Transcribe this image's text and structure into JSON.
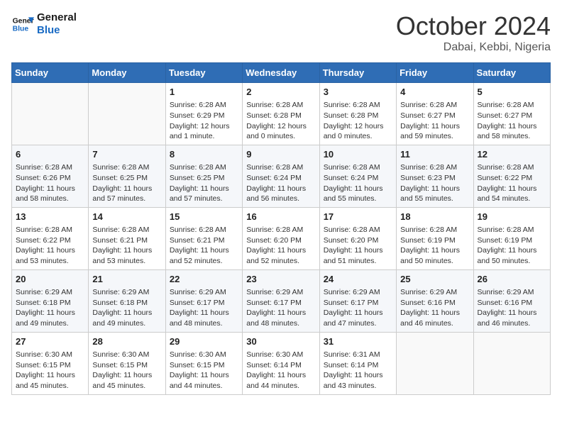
{
  "logo": {
    "line1": "General",
    "line2": "Blue"
  },
  "title": "October 2024",
  "subtitle": "Dabai, Kebbi, Nigeria",
  "weekdays": [
    "Sunday",
    "Monday",
    "Tuesday",
    "Wednesday",
    "Thursday",
    "Friday",
    "Saturday"
  ],
  "weeks": [
    [
      {
        "day": "",
        "info": ""
      },
      {
        "day": "",
        "info": ""
      },
      {
        "day": "1",
        "info": "Sunrise: 6:28 AM\nSunset: 6:29 PM\nDaylight: 12 hours and 1 minute."
      },
      {
        "day": "2",
        "info": "Sunrise: 6:28 AM\nSunset: 6:28 PM\nDaylight: 12 hours and 0 minutes."
      },
      {
        "day": "3",
        "info": "Sunrise: 6:28 AM\nSunset: 6:28 PM\nDaylight: 12 hours and 0 minutes."
      },
      {
        "day": "4",
        "info": "Sunrise: 6:28 AM\nSunset: 6:27 PM\nDaylight: 11 hours and 59 minutes."
      },
      {
        "day": "5",
        "info": "Sunrise: 6:28 AM\nSunset: 6:27 PM\nDaylight: 11 hours and 58 minutes."
      }
    ],
    [
      {
        "day": "6",
        "info": "Sunrise: 6:28 AM\nSunset: 6:26 PM\nDaylight: 11 hours and 58 minutes."
      },
      {
        "day": "7",
        "info": "Sunrise: 6:28 AM\nSunset: 6:25 PM\nDaylight: 11 hours and 57 minutes."
      },
      {
        "day": "8",
        "info": "Sunrise: 6:28 AM\nSunset: 6:25 PM\nDaylight: 11 hours and 57 minutes."
      },
      {
        "day": "9",
        "info": "Sunrise: 6:28 AM\nSunset: 6:24 PM\nDaylight: 11 hours and 56 minutes."
      },
      {
        "day": "10",
        "info": "Sunrise: 6:28 AM\nSunset: 6:24 PM\nDaylight: 11 hours and 55 minutes."
      },
      {
        "day": "11",
        "info": "Sunrise: 6:28 AM\nSunset: 6:23 PM\nDaylight: 11 hours and 55 minutes."
      },
      {
        "day": "12",
        "info": "Sunrise: 6:28 AM\nSunset: 6:22 PM\nDaylight: 11 hours and 54 minutes."
      }
    ],
    [
      {
        "day": "13",
        "info": "Sunrise: 6:28 AM\nSunset: 6:22 PM\nDaylight: 11 hours and 53 minutes."
      },
      {
        "day": "14",
        "info": "Sunrise: 6:28 AM\nSunset: 6:21 PM\nDaylight: 11 hours and 53 minutes."
      },
      {
        "day": "15",
        "info": "Sunrise: 6:28 AM\nSunset: 6:21 PM\nDaylight: 11 hours and 52 minutes."
      },
      {
        "day": "16",
        "info": "Sunrise: 6:28 AM\nSunset: 6:20 PM\nDaylight: 11 hours and 52 minutes."
      },
      {
        "day": "17",
        "info": "Sunrise: 6:28 AM\nSunset: 6:20 PM\nDaylight: 11 hours and 51 minutes."
      },
      {
        "day": "18",
        "info": "Sunrise: 6:28 AM\nSunset: 6:19 PM\nDaylight: 11 hours and 50 minutes."
      },
      {
        "day": "19",
        "info": "Sunrise: 6:28 AM\nSunset: 6:19 PM\nDaylight: 11 hours and 50 minutes."
      }
    ],
    [
      {
        "day": "20",
        "info": "Sunrise: 6:29 AM\nSunset: 6:18 PM\nDaylight: 11 hours and 49 minutes."
      },
      {
        "day": "21",
        "info": "Sunrise: 6:29 AM\nSunset: 6:18 PM\nDaylight: 11 hours and 49 minutes."
      },
      {
        "day": "22",
        "info": "Sunrise: 6:29 AM\nSunset: 6:17 PM\nDaylight: 11 hours and 48 minutes."
      },
      {
        "day": "23",
        "info": "Sunrise: 6:29 AM\nSunset: 6:17 PM\nDaylight: 11 hours and 48 minutes."
      },
      {
        "day": "24",
        "info": "Sunrise: 6:29 AM\nSunset: 6:17 PM\nDaylight: 11 hours and 47 minutes."
      },
      {
        "day": "25",
        "info": "Sunrise: 6:29 AM\nSunset: 6:16 PM\nDaylight: 11 hours and 46 minutes."
      },
      {
        "day": "26",
        "info": "Sunrise: 6:29 AM\nSunset: 6:16 PM\nDaylight: 11 hours and 46 minutes."
      }
    ],
    [
      {
        "day": "27",
        "info": "Sunrise: 6:30 AM\nSunset: 6:15 PM\nDaylight: 11 hours and 45 minutes."
      },
      {
        "day": "28",
        "info": "Sunrise: 6:30 AM\nSunset: 6:15 PM\nDaylight: 11 hours and 45 minutes."
      },
      {
        "day": "29",
        "info": "Sunrise: 6:30 AM\nSunset: 6:15 PM\nDaylight: 11 hours and 44 minutes."
      },
      {
        "day": "30",
        "info": "Sunrise: 6:30 AM\nSunset: 6:14 PM\nDaylight: 11 hours and 44 minutes."
      },
      {
        "day": "31",
        "info": "Sunrise: 6:31 AM\nSunset: 6:14 PM\nDaylight: 11 hours and 43 minutes."
      },
      {
        "day": "",
        "info": ""
      },
      {
        "day": "",
        "info": ""
      }
    ]
  ]
}
